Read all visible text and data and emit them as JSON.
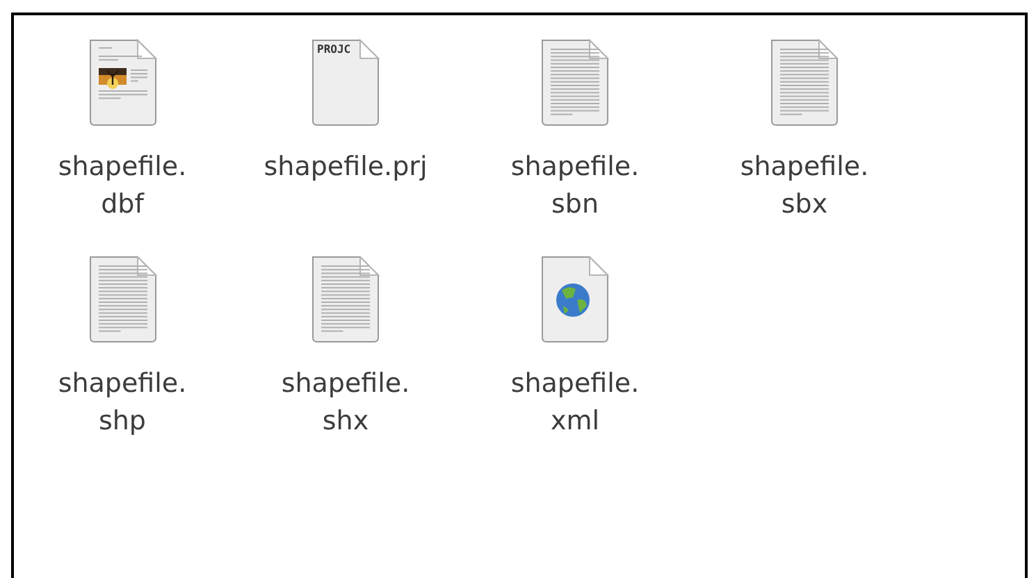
{
  "files": [
    {
      "label_lines": [
        "shapefile.",
        "dbf"
      ],
      "kind": "document-image",
      "selected": false
    },
    {
      "label_lines": [
        "shapefile.prj"
      ],
      "kind": "tagged",
      "tag": "PROJC",
      "selected": false
    },
    {
      "label_lines": [
        "shapefile.",
        "sbn"
      ],
      "kind": "text",
      "selected": false
    },
    {
      "label_lines": [
        "shapefile.",
        "sbx"
      ],
      "kind": "text",
      "selected": false
    },
    {
      "label_lines": [
        "shapefile.",
        "shp"
      ],
      "kind": "text",
      "selected": false
    },
    {
      "label_lines": [
        "shapefile.",
        "shx"
      ],
      "kind": "text",
      "selected": false
    },
    {
      "label_lines": [
        "shapefile.",
        "xml"
      ],
      "kind": "globe",
      "selected": false
    }
  ]
}
